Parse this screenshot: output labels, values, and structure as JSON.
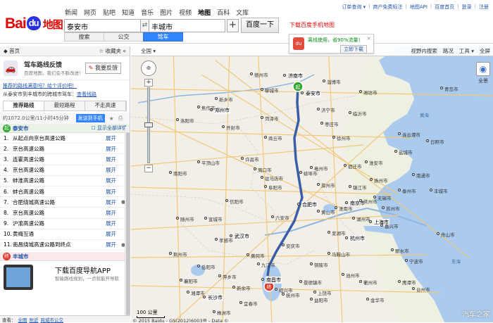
{
  "header": {
    "logo_text": "Bai",
    "logo_du": "du",
    "logo_map": "地图",
    "nav": [
      "新闻",
      "网页",
      "贴吧",
      "知道",
      "音乐",
      "图片",
      "视频",
      "地图",
      "百科",
      "文库"
    ],
    "nav_active": "地图",
    "search_from": "泰安市",
    "search_to": "丰城市",
    "swap_icon": "⇄",
    "plus_icon": "+",
    "search_button": "百度一下",
    "modes": [
      "搜索",
      "公交",
      "驾车"
    ],
    "mode_active": "驾车",
    "download_link": "下载百度手机地图",
    "top_links": [
      "订单查询 ▾",
      "商户免费标注",
      "地图API",
      "百度首页",
      "登录",
      "注册"
    ]
  },
  "promo": {
    "icon": "du",
    "text": "离线使用，省90%流量！",
    "button": "立即下载",
    "close": "×"
  },
  "left_panel": {
    "home": "◆ 首页",
    "favorites": "☆ 收藏夹 «",
    "feedback_title": "驾车路线反馈",
    "feedback_sub": "百度地图，我们会不断改进！",
    "feedback_button_icon": "✎",
    "feedback_button": "我要反馈",
    "evaluate_link": "推荐的路线满意吗？给个评价吧！",
    "route_info_prefix": "从泰安市到丰城市的跨城市驾车：",
    "route_info_link": "查看线路",
    "tabs": [
      "推荐路线",
      "最短路程",
      "不走高速"
    ],
    "tab_active": "推荐路线",
    "distance": "约1072.0公里/11小时45分钟",
    "send_phone": "发送到手机",
    "star_icon": "★",
    "print_icon": "⎙",
    "start_marker": "起",
    "start_name": "泰安市",
    "show_all": "显示全部详情",
    "steps": [
      {
        "n": "1.",
        "text": "从起点向京台高速公路",
        "pin": ""
      },
      {
        "n": "2.",
        "text": "京台高速公路",
        "pin": ""
      },
      {
        "n": "3.",
        "text": "连霍高速公路",
        "pin": ""
      },
      {
        "n": "4.",
        "text": "京台高速公路",
        "pin": ""
      },
      {
        "n": "5.",
        "text": "蚌淮高速公路",
        "pin": ""
      },
      {
        "n": "6.",
        "text": "蚌合高速公路",
        "pin": ""
      },
      {
        "n": "7.",
        "text": "合肥绕城高速公路",
        "pin": "●"
      },
      {
        "n": "8.",
        "text": "京台高速公路",
        "pin": ""
      },
      {
        "n": "9.",
        "text": "沪渝高速公路",
        "pin": ""
      },
      {
        "n": "10.",
        "text": "黄梅互通",
        "pin": ""
      },
      {
        "n": "11.",
        "text": "南昌绕城高速公路到终点",
        "pin": "●"
      }
    ],
    "expand_label": "展开",
    "end_marker": "终",
    "end_name": "丰城市",
    "app_title": "下载百度导航APP",
    "app_sub": "智能路线规划，一点就能开导航",
    "bottom_prefix": "查看：",
    "bottom_links": [
      "全图",
      "附近",
      "跨城市公交"
    ]
  },
  "map": {
    "region_label": "全国 ▾",
    "tools": [
      "视野内搜索",
      "路况",
      "工具 ▾",
      "全屏"
    ],
    "pan_icon": "⊕",
    "zoom_in": "+",
    "zoom_out": "−",
    "pano_icon": "◉",
    "pano_label": "全景",
    "scale": "100 公里",
    "copyright": "© 2015 Baidu - GS(2012)6003号 - Data ©",
    "watermark": "汽车之家",
    "cities": [
      {
        "name": "济南市",
        "big": true
      },
      {
        "name": "泰安市",
        "big": true
      },
      {
        "name": "郑州市",
        "big": true
      },
      {
        "name": "合肥市",
        "big": true
      },
      {
        "name": "南京市",
        "big": true
      },
      {
        "name": "武汉市",
        "big": true
      },
      {
        "name": "上海市",
        "big": true
      },
      {
        "name": "杭州市",
        "big": true
      },
      {
        "name": "南昌市",
        "big": true
      },
      {
        "name": "长沙市",
        "big": true
      },
      {
        "name": "黄海",
        "big": false
      },
      {
        "name": "东海",
        "big": false
      },
      {
        "name": "临沂市",
        "big": false
      },
      {
        "name": "徐州市",
        "big": false
      },
      {
        "name": "开封市",
        "big": false
      },
      {
        "name": "商丘市",
        "big": false
      },
      {
        "name": "淮安市",
        "big": false
      },
      {
        "name": "盐城市",
        "big": false
      },
      {
        "name": "蚌埠市",
        "big": false
      },
      {
        "name": "阜阳市",
        "big": false
      },
      {
        "name": "信阳市",
        "big": false
      },
      {
        "name": "六安市",
        "big": false
      },
      {
        "name": "安庆市",
        "big": false
      },
      {
        "name": "九江市",
        "big": false
      },
      {
        "name": "宁波市",
        "big": false
      },
      {
        "name": "苏州市",
        "big": false
      },
      {
        "name": "常州市",
        "big": false
      },
      {
        "name": "芜湖市",
        "big": false
      },
      {
        "name": "岳阳市",
        "big": false
      },
      {
        "name": "景德镇市",
        "big": false
      },
      {
        "name": "抚州市",
        "big": false
      },
      {
        "name": "宜春市",
        "big": false
      },
      {
        "name": "洛阳市",
        "big": false
      },
      {
        "name": "平顶山市",
        "big": false
      },
      {
        "name": "南阳市",
        "big": false
      },
      {
        "name": "济宁市",
        "big": false
      },
      {
        "name": "潍坊市",
        "big": false
      },
      {
        "name": "淄博市",
        "big": false
      },
      {
        "name": "枣庄市",
        "big": false
      },
      {
        "name": "宿迁市",
        "big": false
      },
      {
        "name": "黄冈市",
        "big": false
      },
      {
        "name": "孝感市",
        "big": false
      },
      {
        "name": "荆州市",
        "big": false
      },
      {
        "name": "湘潭市",
        "big": false
      },
      {
        "name": "株洲市",
        "big": false
      },
      {
        "name": "新余市",
        "big": false
      },
      {
        "name": "萍乡市",
        "big": false
      },
      {
        "name": "上饶市",
        "big": false
      },
      {
        "name": "衢州市",
        "big": false
      },
      {
        "name": "金华市",
        "big": false
      },
      {
        "name": "台州市",
        "big": false
      },
      {
        "name": "舟山市",
        "big": false
      },
      {
        "name": "嘉兴市",
        "big": false
      },
      {
        "name": "湖州市",
        "big": false
      },
      {
        "name": "无锡市",
        "big": false
      },
      {
        "name": "镇江市",
        "big": false
      },
      {
        "name": "扬州市",
        "big": false
      },
      {
        "name": "泰州市",
        "big": false
      },
      {
        "name": "南通市",
        "big": false
      },
      {
        "name": "连云港市",
        "big": false
      },
      {
        "name": "日照市",
        "big": false
      },
      {
        "name": "青岛市",
        "big": false
      },
      {
        "name": "德州市",
        "big": false
      },
      {
        "name": "聊城市",
        "big": false
      },
      {
        "name": "菏泽市",
        "big": false
      },
      {
        "name": "新乡市",
        "big": false
      },
      {
        "name": "焦作市",
        "big": false
      },
      {
        "name": "许昌市",
        "big": false
      },
      {
        "name": "周口市",
        "big": false
      },
      {
        "name": "驻马店市",
        "big": false
      },
      {
        "name": "亳州市",
        "big": false
      },
      {
        "name": "淮南市",
        "big": false
      },
      {
        "name": "滁州市",
        "big": false
      },
      {
        "name": "马鞍山市",
        "big": false
      },
      {
        "name": "铜陵市",
        "big": false
      },
      {
        "name": "池州市",
        "big": false
      },
      {
        "name": "黄山市",
        "big": false
      },
      {
        "name": "宣城市",
        "big": false
      },
      {
        "name": "随州市",
        "big": false
      },
      {
        "name": "襄阳市",
        "big": false
      },
      {
        "name": "益阳市",
        "big": false
      },
      {
        "name": "鹰潭市",
        "big": false
      },
      {
        "name": "丽水市",
        "big": false
      },
      {
        "name": "绍兴市",
        "big": false
      },
      {
        "name": "丰城市",
        "big": false
      }
    ]
  },
  "colors": {
    "accent": "#3385ff",
    "start": "#30a530",
    "end": "#e0392b",
    "route": "#3a5fa6",
    "water": "#aacbee"
  }
}
